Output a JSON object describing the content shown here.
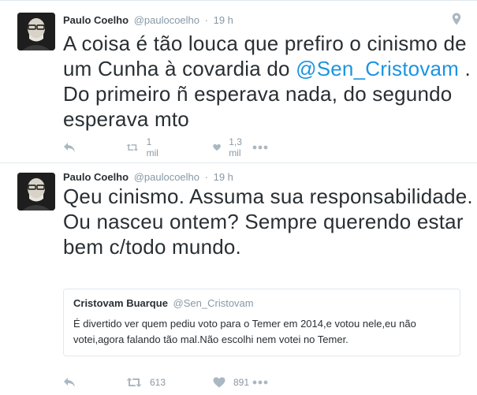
{
  "tweets": [
    {
      "author_name": "Paulo Coelho",
      "author_handle": "@paulocoelho",
      "separator": "·",
      "time": "19 h",
      "text_parts": {
        "before": "A coisa é tão louca que prefiro o cinismo de um Cunha à covardia do ",
        "mention": "@Sen_Cristovam",
        "after": " . Do primeiro ñ esperava nada, do segundo esperava mto"
      },
      "retweets": "1 mil",
      "likes": "1,3 mil",
      "has_location_icon": true
    },
    {
      "author_name": "Paulo Coelho",
      "author_handle": "@paulocoelho",
      "separator": "·",
      "time": "19 h",
      "text": "Qeu cinismo. Assuma sua responsabilidade. Ou nasceu ontem? Sempre querendo estar bem c/todo mundo.",
      "quoted": {
        "author_name": "Cristovam Buarque",
        "author_handle": "@Sen_Cristovam",
        "text": "É divertido ver quem pediu voto para o Temer em 2014,e votou nele,eu não votei,agora falando tão mal.Não escolhi nem votei no Temer."
      },
      "retweets": "613",
      "likes": "891"
    }
  ],
  "icons": {
    "reply": "reply-icon",
    "retweet": "retweet-icon",
    "like": "heart-icon",
    "more": "more-icon",
    "location": "location-icon"
  },
  "colors": {
    "text": "#292f33",
    "secondary": "#8899a6",
    "link": "#1b95e0",
    "border": "#e1e8ed"
  }
}
